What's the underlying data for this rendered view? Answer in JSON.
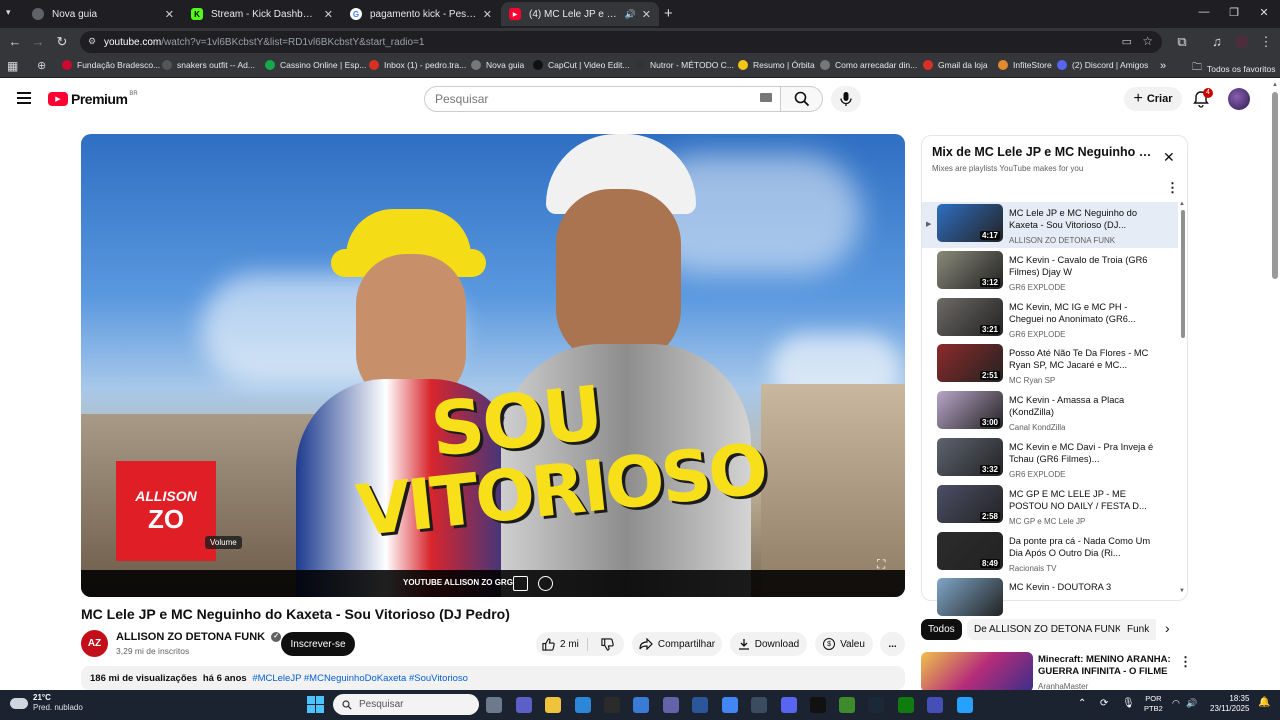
{
  "browser": {
    "tabs": [
      {
        "label": "Nova guia",
        "icon": "chrome-icon",
        "color": "#3c3c3c"
      },
      {
        "label": "Stream - Kick Dashboard",
        "icon": "kick-icon",
        "color": "#53fc18"
      },
      {
        "label": "pagamento kick - Pesquisa Goo",
        "icon": "google-icon",
        "color": "#4285f4"
      },
      {
        "label": "(4) MC Lele JP e MC Negui",
        "icon": "youtube-icon",
        "color": "#ff0033"
      }
    ],
    "url_host": "youtube.com",
    "url_rest": "/watch?v=1vl6BKcbstY&list=RD1vl6BKcbstY&start_radio=1",
    "bookmarks": [
      {
        "label": "Fundação Bradesco...",
        "color": "#cc092f"
      },
      {
        "label": "snakers outfit -- Ad...",
        "color": "#555555"
      },
      {
        "label": "Cassino Online | Esp...",
        "color": "#17a84a"
      },
      {
        "label": "Inbox (1) - pedro.tra...",
        "color": "#d93025"
      },
      {
        "label": "Nova guia",
        "color": "#777777"
      },
      {
        "label": "CapCut | Video Edit...",
        "color": "#111111"
      },
      {
        "label": "Nutror - MÉTODO C...",
        "color": "#333333"
      },
      {
        "label": "Resumo | Órbita",
        "color": "#f5c518"
      },
      {
        "label": "Como arrecadar din...",
        "color": "#777777"
      },
      {
        "label": "Gmail da loja",
        "color": "#d93025"
      },
      {
        "label": "InfiteStore",
        "color": "#e38b2c"
      },
      {
        "label": "(2) Discord | Amigos",
        "color": "#5865f2"
      }
    ],
    "all_bookmarks": "Todos os favoritos",
    "more_bookmarks": "»"
  },
  "youtube": {
    "logo_text": "Premium",
    "logo_region": "BR",
    "search_placeholder": "Pesquisar",
    "create_label": "Criar",
    "notification_count": "4",
    "video": {
      "title": "MC Lele JP e MC Neguinho do Kaxeta - Sou Vitorioso (DJ Pedro)",
      "thumb_line1": "SOU",
      "thumb_line2": "VITORIOSO",
      "watermark": "YOUTUBE  ALLISON ZO GRG",
      "volume_label": "Volume",
      "logo_top": "ALLISON",
      "logo_bottom": "ZO"
    },
    "channel": {
      "name": "ALLISON ZO DETONA FUNK",
      "subscribers": "3,29 mi de inscritos",
      "avatar_text": "AZ",
      "subscribe_label": "Inscrever-se"
    },
    "actions": {
      "likes": "2 mi",
      "share": "Compartilhar",
      "download": "Download",
      "thanks": "Valeu",
      "more": "..."
    },
    "description": {
      "views": "186 mi de visualizações",
      "age": "há 6 anos",
      "tags": "#MCLeleJP #MCNeguinhoDoKaxeta #SouVitorioso"
    },
    "playlist": {
      "title": "Mix de MC Lele JP e MC Neguinho d...",
      "subtitle": "Mixes are playlists YouTube makes for you",
      "now_playing_marker": "▶",
      "items": [
        {
          "title": "MC Lele JP e MC Neguinho do Kaxeta - Sou Vitorioso (DJ...",
          "channel": "ALLISON ZO DETONA FUNK",
          "duration": "4:17",
          "color": "#2f6fc2"
        },
        {
          "title": "MC Kevin - Cavalo de Troia (GR6 Filmes) Djay W",
          "channel": "GR6 EXPLODE",
          "duration": "3:12",
          "color": "#8a8a7a"
        },
        {
          "title": "MC Kevin, MC IG e MC PH - Cheguei no Anonimato (GR6...",
          "channel": "GR6 EXPLODE",
          "duration": "3:21",
          "color": "#6d6a66"
        },
        {
          "title": "Posso Até Não Te Da Flores - MC Ryan SP, MC Jacaré e MC...",
          "channel": "MC Ryan SP",
          "duration": "2:51",
          "color": "#8d2a2a"
        },
        {
          "title": "MC Kevin - Amassa a Placa (KondZilla)",
          "channel": "Canal KondZilla",
          "duration": "3:00",
          "color": "#b9a5c8"
        },
        {
          "title": "MC Kevin e MC Davi - Pra Inveja é Tchau (GR6 Filmes)...",
          "channel": "GR6 EXPLODE",
          "duration": "3:32",
          "color": "#5d6470"
        },
        {
          "title": "MC GP E MC LELE JP - ME POSTOU NO DAILY / FESTA D...",
          "channel": "MC GP e MC Lele JP",
          "duration": "2:58",
          "color": "#4c4f67"
        },
        {
          "title": "Da ponte pra cá - Nada Como Um Dia Após O Outro Dia (Ri...",
          "channel": "Racionais TV",
          "duration": "8:49",
          "color": "#2c2c2c"
        },
        {
          "title": "MC Kevin - DOUTORA 3",
          "channel": "",
          "duration": "",
          "color": "#7fa6c8"
        }
      ]
    },
    "chips": [
      "Todos",
      "De ALLISON ZO DETONA FUNK",
      "Funk"
    ],
    "related": {
      "title": "Minecraft: MENINO ARANHA: GUERRA INFINITA - O FILME",
      "channel": "AranhaMaster"
    }
  },
  "taskbar": {
    "temperature": "21°C",
    "weather": "Pred. nublado",
    "search_placeholder": "Pesquisar",
    "lang": "POR",
    "layout": "PTB2",
    "time": "18:35",
    "date": "23/11/2025"
  }
}
